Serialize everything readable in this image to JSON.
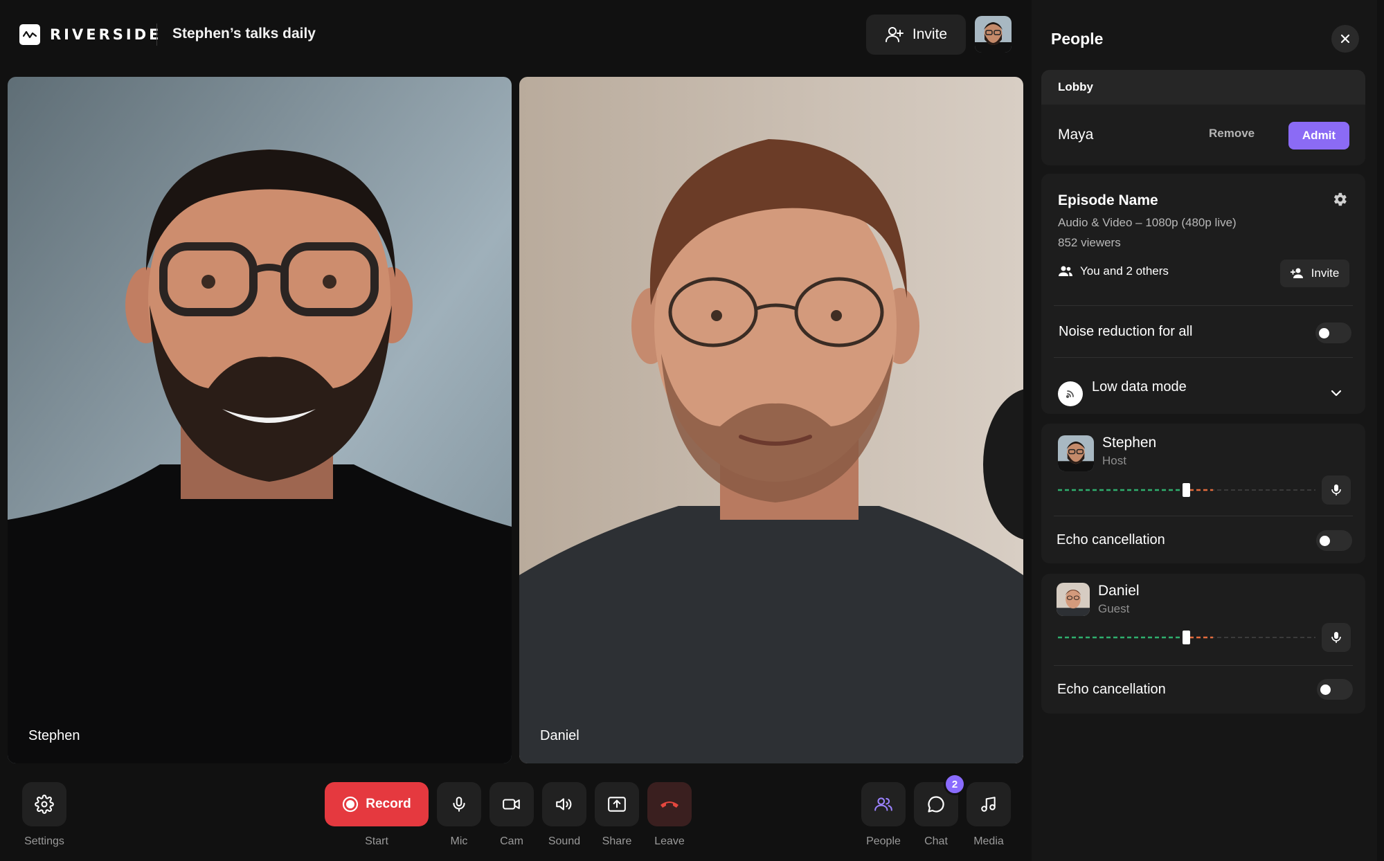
{
  "header": {
    "logo_text": "RIVERSIDE",
    "studio_title": "Stephen’s talks daily",
    "invite_label": "Invite"
  },
  "tiles": [
    {
      "name": "Stephen"
    },
    {
      "name": "Daniel"
    }
  ],
  "controls": {
    "settings_label": "Settings",
    "record_label": "Record",
    "start_label": "Start",
    "mic_label": "Mic",
    "cam_label": "Cam",
    "sound_label": "Sound",
    "share_label": "Share",
    "leave_label": "Leave",
    "people_label": "People",
    "chat_label": "Chat",
    "chat_badge": "2",
    "media_label": "Media"
  },
  "panel": {
    "title": "People",
    "lobby": {
      "heading": "Lobby",
      "guest_name": "Maya",
      "remove_label": "Remove",
      "admit_label": "Admit"
    },
    "episode": {
      "name": "Episode Name",
      "format": "Audio & Video – 1080p (480p live)",
      "viewers": "852 viewers",
      "participants": "You and 2 others",
      "invite_label": "Invite",
      "noise_label": "Noise reduction for all",
      "noise_on": false,
      "low_data_label": "Low data mode"
    },
    "participants": [
      {
        "name": "Stephen",
        "role": "Host",
        "echo_label": "Echo cancellation",
        "echo_on": false,
        "volume": 0.5
      },
      {
        "name": "Daniel",
        "role": "Guest",
        "echo_label": "Echo cancellation",
        "echo_on": false,
        "volume": 0.5
      }
    ]
  },
  "colors": {
    "accent": "#8b6bf5",
    "record": "#e5393f",
    "leave_icon": "#e5473e",
    "background": "#111111",
    "panel": "#161616"
  }
}
